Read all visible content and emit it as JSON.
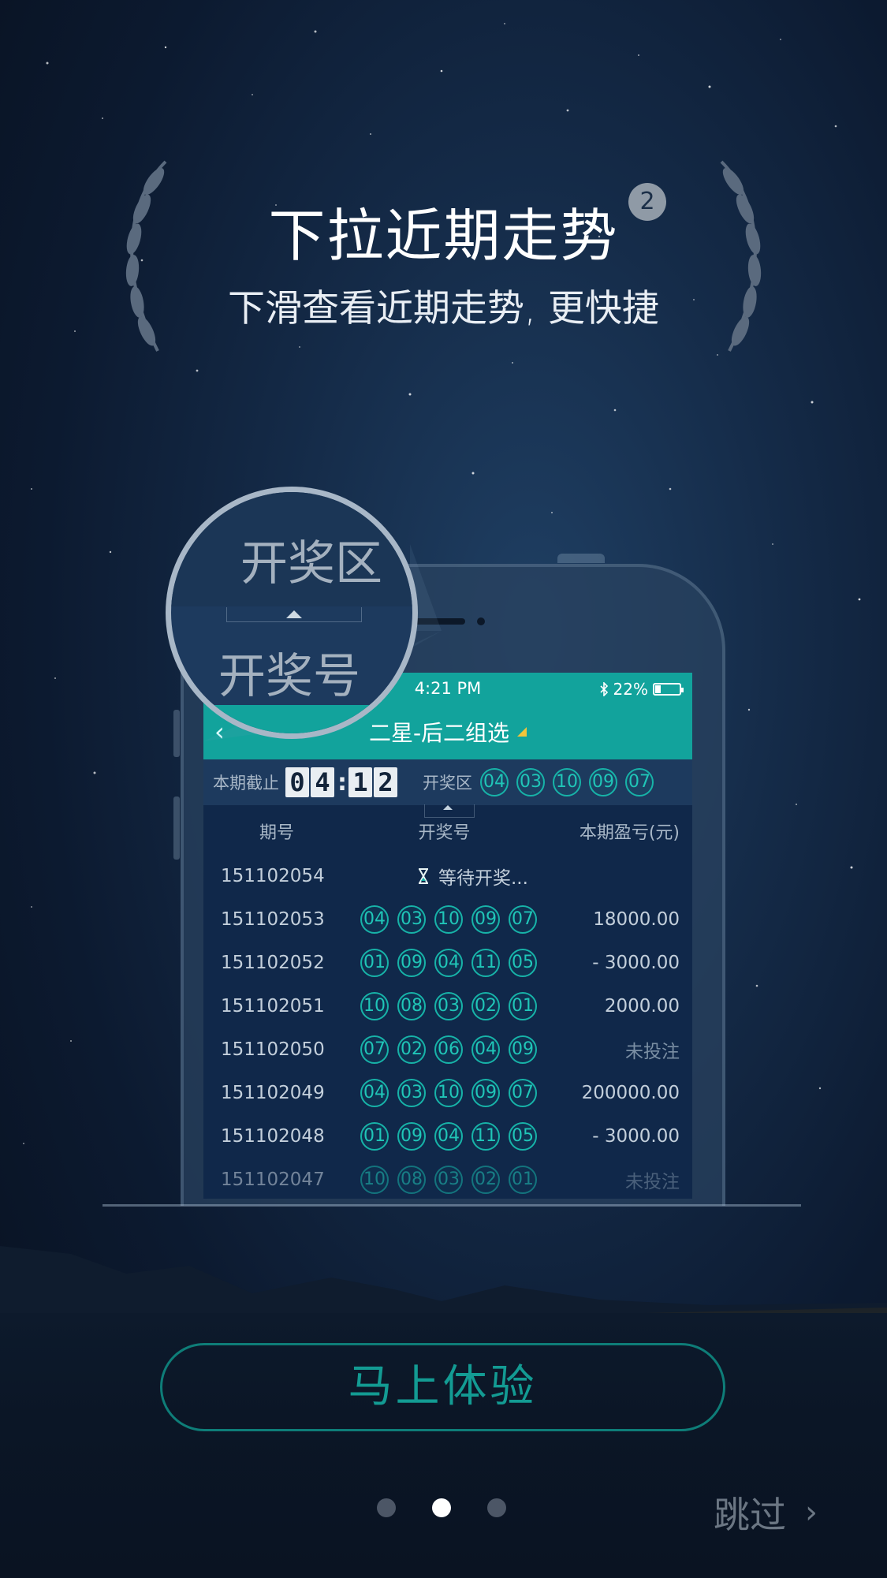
{
  "intro": {
    "title": "下拉近期走势",
    "step_badge": "2",
    "subtitle": "下滑查看近期走势, 更快捷"
  },
  "magnifier": {
    "top_label": "开奖区",
    "bottom_label": "开奖号"
  },
  "phone_screen": {
    "status_bar": {
      "time": "4:21 PM",
      "battery": "22%",
      "battery_level": 0.22,
      "icons": [
        "bluetooth-icon",
        "battery-icon"
      ]
    },
    "nav": {
      "back_icon": "‹",
      "title": "二星-后二组选"
    },
    "draw_bar": {
      "countdown_label": "本期截止",
      "countdown_digits": [
        "0",
        "4",
        "1",
        "2"
      ],
      "countdown_separator": ":",
      "draw_area_label": "开奖区",
      "draw_numbers": [
        "04",
        "03",
        "10",
        "09",
        "07"
      ]
    },
    "table": {
      "headers": [
        "期号",
        "开奖号",
        "本期盈亏(元)"
      ],
      "waiting_row": {
        "period": "151102054",
        "status": "等待开奖..."
      },
      "rows": [
        {
          "period": "151102053",
          "numbers": [
            "04",
            "03",
            "10",
            "09",
            "07"
          ],
          "profit": "18000.00"
        },
        {
          "period": "151102052",
          "numbers": [
            "01",
            "09",
            "04",
            "11",
            "05"
          ],
          "profit": "- 3000.00"
        },
        {
          "period": "151102051",
          "numbers": [
            "10",
            "08",
            "03",
            "02",
            "01"
          ],
          "profit": "2000.00"
        },
        {
          "period": "151102050",
          "numbers": [
            "07",
            "02",
            "06",
            "04",
            "09"
          ],
          "profit": "未投注"
        },
        {
          "period": "151102049",
          "numbers": [
            "04",
            "03",
            "10",
            "09",
            "07"
          ],
          "profit": "200000.00"
        },
        {
          "period": "151102048",
          "numbers": [
            "01",
            "09",
            "04",
            "11",
            "05"
          ],
          "profit": "- 3000.00"
        },
        {
          "period": "151102047",
          "numbers": [
            "10",
            "08",
            "03",
            "02",
            "01"
          ],
          "profit": "未投注"
        }
      ]
    }
  },
  "cta": {
    "label": "马上体验"
  },
  "pager": {
    "count": 3,
    "active": 2
  },
  "skip": {
    "label": "跳过",
    "chevron": "›"
  },
  "colors": {
    "accent": "#12a39c",
    "cta_text": "#139b93",
    "background": "#142a47"
  }
}
